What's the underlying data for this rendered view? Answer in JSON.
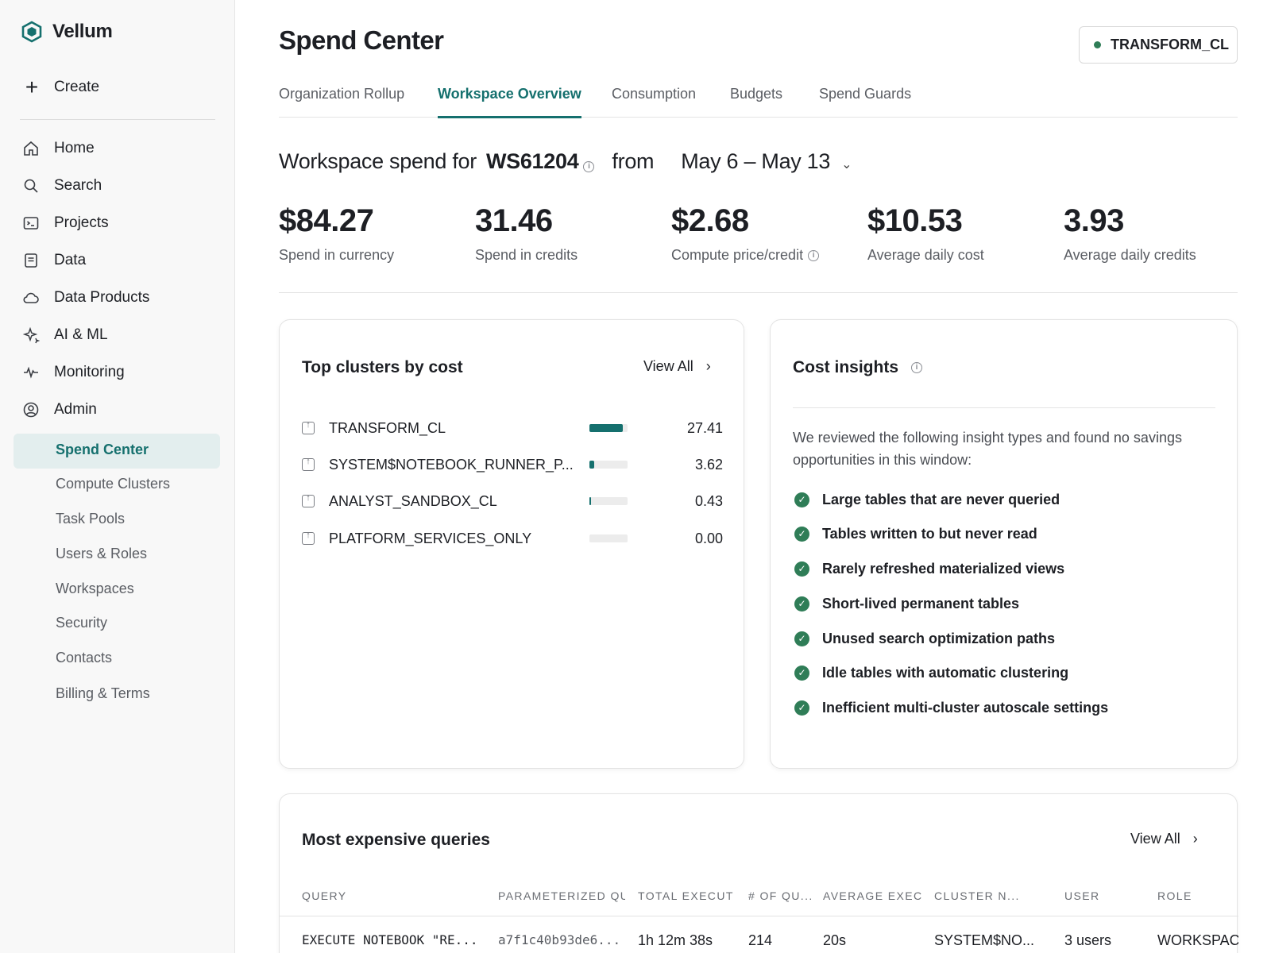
{
  "brand": {
    "name": "Vellum",
    "accent": "#15706e"
  },
  "sidebar": {
    "create_label": "Create",
    "items": [
      {
        "label": "Home",
        "icon": "home-icon"
      },
      {
        "label": "Search",
        "icon": "search-icon"
      },
      {
        "label": "Projects",
        "icon": "terminal-icon"
      },
      {
        "label": "Data",
        "icon": "document-icon"
      },
      {
        "label": "Data Products",
        "icon": "cloud-icon"
      },
      {
        "label": "AI & ML",
        "icon": "sparkle-icon"
      },
      {
        "label": "Monitoring",
        "icon": "pulse-icon"
      },
      {
        "label": "Admin",
        "icon": "user-circle-icon"
      }
    ],
    "admin_subitems": [
      {
        "label": "Spend Center",
        "active": true
      },
      {
        "label": "Compute Clusters"
      },
      {
        "label": "Task Pools"
      },
      {
        "label": "Users & Roles"
      },
      {
        "label": "Workspaces"
      },
      {
        "label": "Security"
      },
      {
        "label": "Contacts"
      },
      {
        "label": "Billing & Terms"
      }
    ]
  },
  "header": {
    "title": "Spend Center",
    "cluster_chip": "TRANSFORM_CL",
    "tabs": [
      {
        "label": "Organization Rollup"
      },
      {
        "label": "Workspace Overview",
        "active": true
      },
      {
        "label": "Consumption"
      },
      {
        "label": "Budgets"
      },
      {
        "label": "Spend Guards"
      }
    ]
  },
  "spend": {
    "prefix": "Workspace spend for",
    "workspace": "WS61204",
    "from": "from",
    "range": "May 6 – May 13"
  },
  "metrics": [
    {
      "value": "$84.27",
      "label": "Spend in currency"
    },
    {
      "value": "31.46",
      "label": "Spend in credits"
    },
    {
      "value": "$2.68",
      "label": "Compute price/credit",
      "info": true
    },
    {
      "value": "$10.53",
      "label": "Average daily cost"
    },
    {
      "value": "3.93",
      "label": "Average daily credits"
    }
  ],
  "top_clusters": {
    "title": "Top clusters by cost",
    "view_all": "View All",
    "rows": [
      {
        "name": "TRANSFORM_CL",
        "value": "27.41",
        "share": 0.872
      },
      {
        "name": "SYSTEM$NOTEBOOK_RUNNER_P...",
        "value": "3.62",
        "share": 0.115
      },
      {
        "name": "ANALYST_SANDBOX_CL",
        "value": "0.43",
        "share": 0.014
      },
      {
        "name": "PLATFORM_SERVICES_ONLY",
        "value": "0.00",
        "share": 0
      }
    ]
  },
  "insights": {
    "title": "Cost insights",
    "intro": "We reviewed the following insight types and found no savings opportunities in this window:",
    "items": [
      "Large tables that are never queried",
      "Tables written to but never read",
      "Rarely refreshed materialized views",
      "Short-lived permanent tables",
      "Unused search optimization paths",
      "Idle tables with automatic clustering",
      "Inefficient multi-cluster autoscale settings"
    ]
  },
  "queries": {
    "title": "Most expensive queries",
    "view_all": "View All",
    "columns": [
      "QUERY",
      "PARAMETERIZED QU",
      "TOTAL EXECUT",
      "# OF QU...",
      "AVERAGE EXEC",
      "CLUSTER N...",
      "USER",
      "ROLE"
    ],
    "rows": [
      [
        "EXECUTE NOTEBOOK \"RE...",
        "a7f1c40b93de6...",
        "1h 12m 38s",
        "214",
        "20s",
        "SYSTEM$NO...",
        "3 users",
        "WORKSPAC"
      ]
    ]
  }
}
